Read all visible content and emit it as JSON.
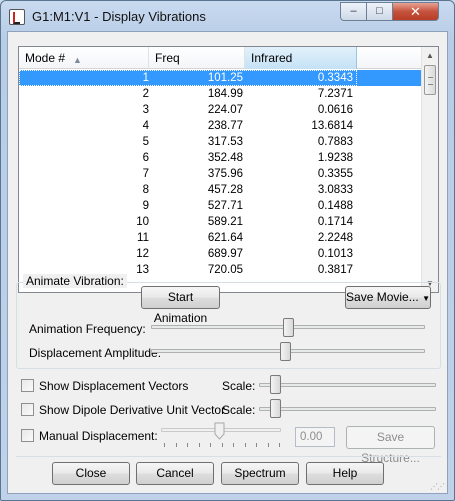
{
  "window": {
    "title": "G1:M1:V1 - Display Vibrations"
  },
  "caption": {
    "minimize": "–",
    "maximize": "□",
    "close": "✕"
  },
  "list": {
    "columns": [
      "Mode #",
      "Freq",
      "Infrared"
    ],
    "rows": [
      {
        "mode": "1",
        "freq": "101.25",
        "ir": "0.3343"
      },
      {
        "mode": "2",
        "freq": "184.99",
        "ir": "7.2371"
      },
      {
        "mode": "3",
        "freq": "224.07",
        "ir": "0.0616"
      },
      {
        "mode": "4",
        "freq": "238.77",
        "ir": "13.6814"
      },
      {
        "mode": "5",
        "freq": "317.53",
        "ir": "0.7883"
      },
      {
        "mode": "6",
        "freq": "352.48",
        "ir": "1.9238"
      },
      {
        "mode": "7",
        "freq": "375.96",
        "ir": "0.3355"
      },
      {
        "mode": "8",
        "freq": "457.28",
        "ir": "3.0833"
      },
      {
        "mode": "9",
        "freq": "527.71",
        "ir": "0.1488"
      },
      {
        "mode": "10",
        "freq": "589.21",
        "ir": "0.1714"
      },
      {
        "mode": "11",
        "freq": "621.64",
        "ir": "2.2248"
      },
      {
        "mode": "12",
        "freq": "689.97",
        "ir": "0.1013"
      },
      {
        "mode": "13",
        "freq": "720.05",
        "ir": "0.3817"
      }
    ],
    "selected_index": 0
  },
  "animate": {
    "group_label": "Animate Vibration:",
    "start_button": "Start Animation",
    "save_movie_button": "Save Movie...",
    "frequency_label": "Animation Frequency:",
    "frequency_level": 0.5,
    "amplitude_label": "Displacement Amplitude:",
    "amplitude_level": 0.49
  },
  "options": {
    "show_vectors_label": "Show Displacement Vectors",
    "show_vectors_checked": false,
    "show_dipole_label": "Show Dipole Derivative Unit Vector",
    "show_dipole_checked": false,
    "scale_label": "Scale:",
    "manual_label": "Manual Displacement:",
    "manual_checked": false,
    "manual_value": "0.00",
    "save_structure_button": "Save Structure..."
  },
  "footer": {
    "close_button": "Close",
    "cancel_button": "Cancel",
    "spectrum_button": "Spectrum",
    "help_button": "Help"
  }
}
